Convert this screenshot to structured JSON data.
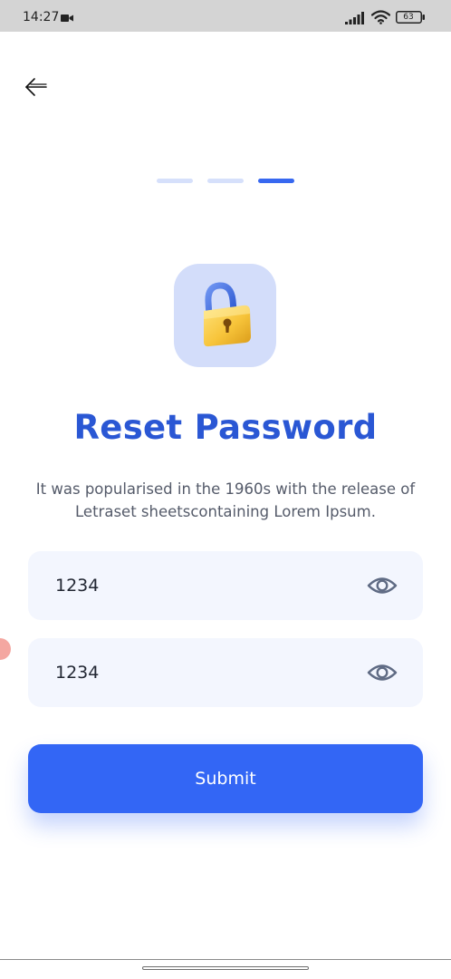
{
  "status_bar": {
    "time": "14:27",
    "battery_level": "63",
    "icons": [
      "video-camera-icon",
      "signal-icon",
      "wifi-icon",
      "battery-icon"
    ]
  },
  "header": {
    "back_icon": "arrow-left-icon"
  },
  "progress": {
    "steps": 3,
    "current_step": 3
  },
  "illustration": {
    "icon": "padlock-icon"
  },
  "reset": {
    "title": "Reset Password",
    "description": "It was popularised in the 1960s with the release of Letraset sheetscontaining Lorem Ipsum."
  },
  "fields": {
    "password": {
      "value": "1234",
      "icon": "eye-icon"
    },
    "confirm_password": {
      "value": "1234",
      "icon": "eye-icon"
    }
  },
  "actions": {
    "submit_label": "Submit"
  },
  "colors": {
    "primary": "#3366f5",
    "title": "#2a57d4",
    "field_bg": "#f3f6fe",
    "tile_bg": "#d3ddfa",
    "step_inactive": "#d6e0fb",
    "step_active": "#3768f0"
  }
}
